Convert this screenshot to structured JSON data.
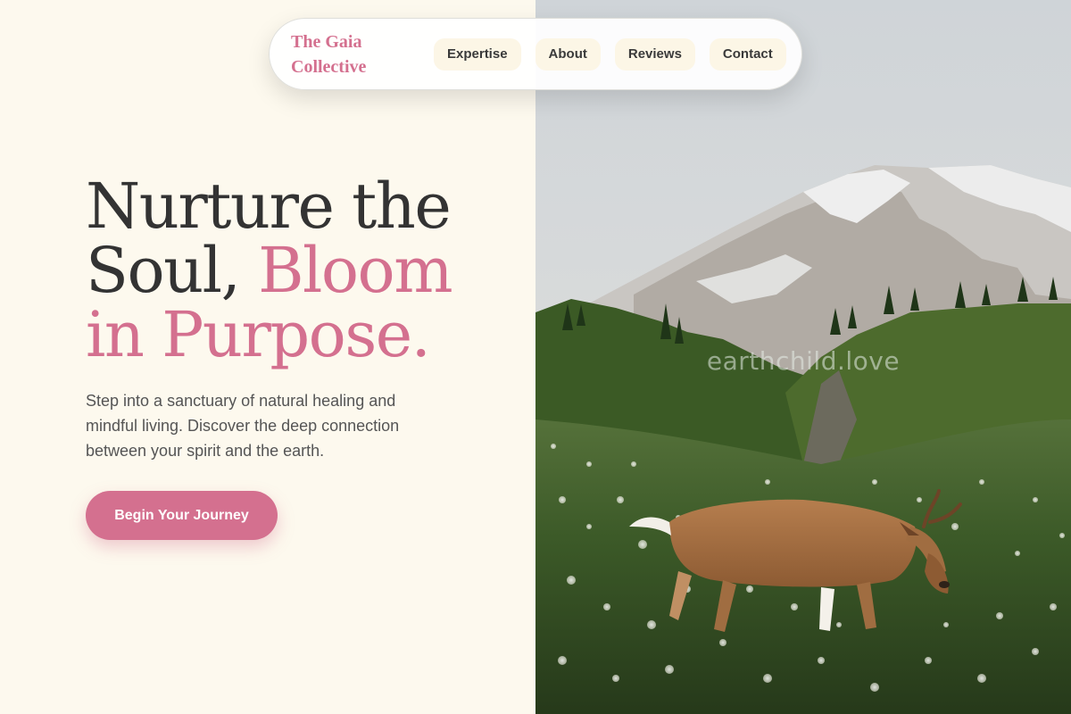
{
  "nav": {
    "brand": "The Gaia Collective",
    "links": [
      {
        "label": "Expertise"
      },
      {
        "label": "About"
      },
      {
        "label": "Reviews"
      },
      {
        "label": "Contact"
      }
    ]
  },
  "hero": {
    "headline_part1": "Nurture the Soul, ",
    "headline_accent": "Bloom in Purpose.",
    "subtext": "Step into a sanctuary of natural healing and mindful living. Discover the deep connection between your spirit and the earth.",
    "cta_label": "Begin Your Journey"
  },
  "image": {
    "watermark": "earthchild.love",
    "subject": "deer-in-mountain-meadow"
  },
  "colors": {
    "background": "#fdf9ee",
    "accent": "#d4708f",
    "heading": "#333333",
    "body_text": "#555555"
  }
}
